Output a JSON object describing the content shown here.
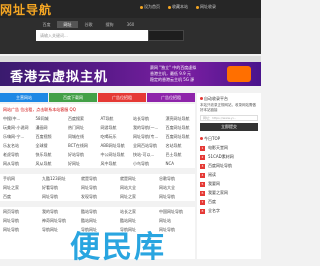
{
  "header": {
    "logo": "网址导航",
    "links": [
      "设为首页",
      "收藏本站",
      "网址收录"
    ]
  },
  "search": {
    "tabs": [
      "百度",
      "网址",
      "谷歌",
      "搜狗",
      "360"
    ],
    "active_tab": "网址",
    "placeholder": "请输入关键词..."
  },
  "banner": {
    "headline": "香港云虚拟主机",
    "sub": [
      "赛网 \"独立\" 中的百度虚拟",
      "香港主机，最低 9.9 元",
      "稳定的香港云主机 5G 源"
    ]
  },
  "color_tabs": [
    {
      "label": "主营网站",
      "color": "#1e88e5"
    },
    {
      "label": "百度下载网",
      "color": "#43a047"
    },
    {
      "label": "广告位招租",
      "color": "#e53935"
    },
    {
      "label": "广告位招租",
      "color": "#8e24aa"
    }
  ],
  "main": {
    "title": "网站广告 位出租，点击联系本站客服 QQ",
    "rows_a": [
      [
        "中搜(中...",
        "58同城",
        "百度搜索",
        "AT导航",
        "站长导航",
        "漂亮网址导航"
      ],
      [
        "玩美网-小说网",
        "漫画网",
        "热门网址",
        "网游导航",
        "我的导航(一...",
        "百度网址导航"
      ],
      [
        "乐嗨网-宁...",
        "百度视频",
        "同城在线",
        "吃喝玩乐",
        "网址导航(专...",
        "百度网址导航"
      ],
      [
        "乐友名站",
        "全球搜",
        "BCT在线网",
        "ABB网址导航",
        "全网百站导航",
        "名站导航"
      ],
      [
        "老虎导航",
        "快乐导航",
        "好站导航",
        "中公网址导航",
        "快站-可以...",
        "巴士导航"
      ],
      [
        "网从导航",
        "风从导航",
        "好网址",
        "风中导航",
        "小鸟导航",
        "NCA"
      ]
    ],
    "rows_b": [
      [
        "手机网",
        "九酷123网址",
        "就是导航",
        "就是网址",
        "谷歌导航"
      ],
      [
        "网址之家",
        "好看导航",
        "网址导航",
        "网站大全",
        "网站大全"
      ],
      [
        "百度",
        "网址导航",
        "发现导航",
        "网址之家",
        "网址导航"
      ]
    ],
    "rows_c": [
      [
        "网页导航",
        "我的导航",
        "酷站导航",
        "站长之家",
        "中国网址导航"
      ],
      [
        "网址导航",
        "神奇网址导航",
        "酷站网址",
        "酷站网址",
        "网址站"
      ],
      [
        "网址导航",
        "导航网址",
        "导航网址",
        "导航网址",
        "网址导航"
      ]
    ]
  },
  "side": {
    "submit_title": "自动收录平台",
    "submit_desc": "本站只收录正规网站，收录网站需做好本站链接",
    "submit_placeholder": "网址：https://www.yi...",
    "submit_button": "立即提交",
    "top_title": "今日TOP",
    "top_items": [
      "电影天堂网",
      "51CAD素材网",
      "百度网址导航",
      "阅读",
      "我要网",
      "我要之家网",
      "百度",
      "全名字"
    ]
  },
  "watermark": "便民库"
}
